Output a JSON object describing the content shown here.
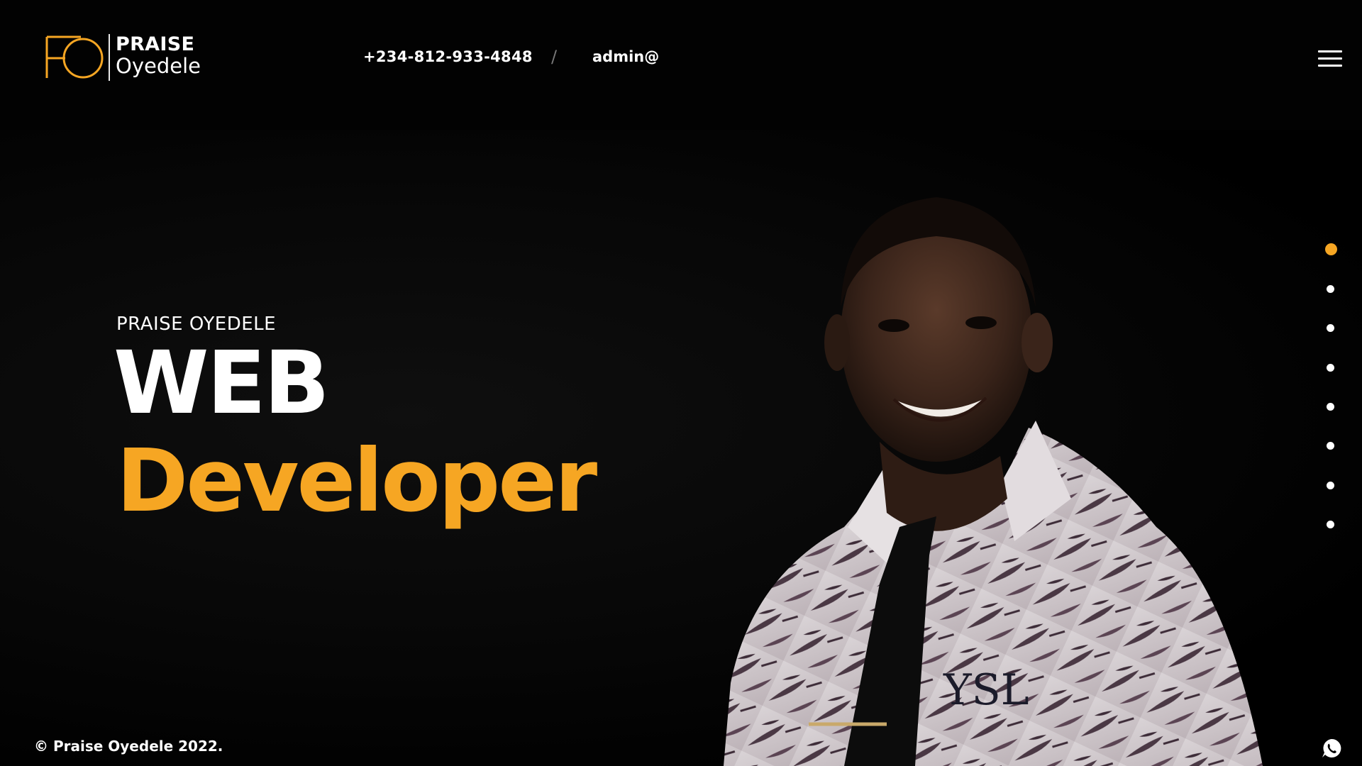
{
  "header": {
    "logo": {
      "monogram": "PO",
      "first_name": "PRAISE",
      "last_name": "Oyedele"
    },
    "contact": {
      "phone": "+234-812-933-4848",
      "separator": "/",
      "email": "admin@"
    },
    "menu_icon": "hamburger-menu-icon"
  },
  "hero": {
    "eyebrow": "PRAISE OYEDELE",
    "title_line_1": "WEB",
    "title_line_2": "Developer",
    "portrait": "portrait of man in floral shirt and black tie"
  },
  "slider": {
    "total": 8,
    "active_index": 0
  },
  "footer": {
    "copyright": "© Praise Oyedele 2022.",
    "chat_icon": "whatsapp-icon"
  },
  "colors": {
    "background": "#000000",
    "accent": "#f6a623",
    "text": "#ffffff"
  }
}
